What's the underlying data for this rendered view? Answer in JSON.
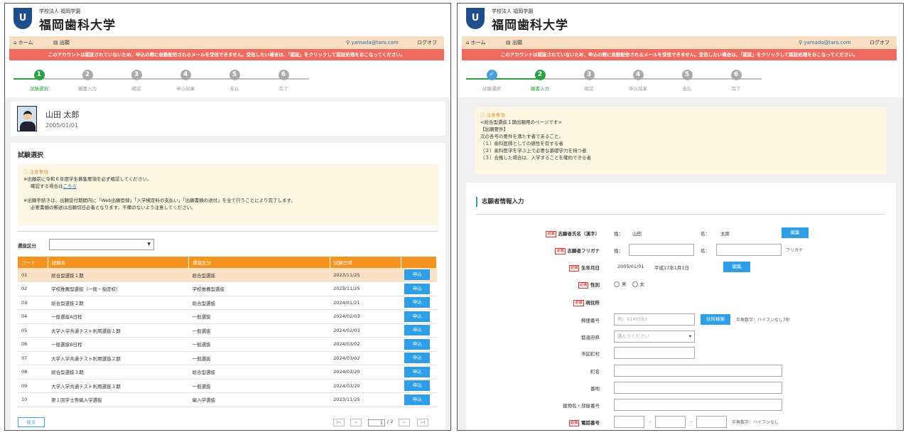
{
  "header": {
    "corp": "学校法人 福岡学園",
    "name": "福岡歯科大学",
    "logo_text": "U"
  },
  "nav": {
    "home": "ホーム",
    "apply": "出願",
    "user": "yamada@taro.com",
    "logout": "ログオフ"
  },
  "alert": "このアカウントは認証されていないため、申込の際に自動配信されるメールを受信できません。受信したい場合は、「認証」をクリックして認証処理をおこなってください。",
  "steps": [
    "試験選択",
    "願書入力",
    "確認",
    "申込結果",
    "支払",
    "完了"
  ],
  "step_nums": [
    "1",
    "2",
    "3",
    "4",
    "5",
    "6"
  ],
  "check_mark": "✓",
  "profile": {
    "name": "山田 太郎",
    "dob": "2005/01/01"
  },
  "left": {
    "title": "試験選択",
    "notice_title": "ⓘ 注意事項",
    "notice_l1": "※出願前に令和６年度学生募集要項を必ず確認してください。",
    "notice_l2a": "確認する場合は",
    "notice_link": "こちら",
    "notice_l3": "※出願手続きは、出願受付期間内に「Web出願登録」「入学検定料の支払い」「出願書類の送付」を全て行うことにより完了します。",
    "notice_l4": "必要書類の郵送は出願切日必着となります。不備のないよう注意してください。",
    "filter_label": "選抜区分",
    "filter_value": "",
    "columns": [
      "コード",
      "試験名",
      "選抜区分",
      "試験日時",
      ""
    ],
    "rows": [
      {
        "code": "01",
        "name": "総合型選抜１期",
        "cat": "総合型選抜",
        "date": "2023/11/25"
      },
      {
        "code": "02",
        "name": "学校推薦型選抜（一般・指定校）",
        "cat": "学校推薦型選抜",
        "date": "2023/11/25"
      },
      {
        "code": "03",
        "name": "総合型選抜２期",
        "cat": "総合型選抜",
        "date": "2024/01/21"
      },
      {
        "code": "04",
        "name": "一般選抜A日程",
        "cat": "一般選抜",
        "date": "2024/02/03"
      },
      {
        "code": "05",
        "name": "大学入学共通テスト利用選抜１期",
        "cat": "一般選抜",
        "date": "2024/02/03"
      },
      {
        "code": "06",
        "name": "一般選抜B日程",
        "cat": "一般選抜",
        "date": "2024/03/02"
      },
      {
        "code": "07",
        "name": "大学入学共通テスト利用選抜２期",
        "cat": "一般選抜",
        "date": "2024/03/02"
      },
      {
        "code": "08",
        "name": "総合型選抜３期",
        "cat": "総合型選抜",
        "date": "2024/03/20"
      },
      {
        "code": "09",
        "name": "大学入学共通テスト利用選抜３期",
        "cat": "一般選抜",
        "date": "2024/03/20"
      },
      {
        "code": "10",
        "name": "第１回学士等編入学選抜",
        "cat": "編入学選抜",
        "date": "2023/11/25"
      }
    ],
    "apply_label": "申込",
    "back_label": "戻る",
    "page_current": "1",
    "page_total": "/ 2",
    "pager": {
      "first": "|<",
      "prev": "<",
      "next": ">",
      "last": ">|"
    }
  },
  "right": {
    "notice_title": "ⓘ 注意事項",
    "notice_lines": [
      "<総合型選抜１期出願用のページです>",
      "【出願要件】",
      "次の各号の要件を満たす者であること。",
      "（１）歯科医師としての適性を有する者",
      "（２）歯科医学を学ぶ上で必要な基礎学力を持つ者",
      "（３）合格した場合は、入学することを確約できる者"
    ],
    "form_title": "志願者情報入力",
    "req": "必須",
    "name_label": "志願者氏名（漢字）",
    "sei": "姓：",
    "mei": "名：",
    "name_sei": "山田",
    "name_mei": "太郎",
    "edit": "編集",
    "kana_label": "志願者フリガナ",
    "kana_hint": "フリガナ",
    "dob_label": "生年月日",
    "dob_value": "2005/01/01",
    "dob_wareki": "平成17年1月1日",
    "sex_label": "性別",
    "male": "男",
    "female": "女",
    "addr_label": "現住所",
    "zip_label": "郵便番号",
    "zip_ph": "例）8140193",
    "zip_btn": "住所検索",
    "zip_hint": "半角数字：ハイフンなし7桁",
    "pref_label": "都道府県",
    "pref_ph": "選んでください",
    "city_label": "市区町村",
    "town_label": "町名",
    "block_label": "番地",
    "bldg_label": "建物名・部屋番号",
    "tel_label": "電話番号",
    "tel_sep": "-",
    "tel_hint": "半角数字：ハイフンなし"
  }
}
